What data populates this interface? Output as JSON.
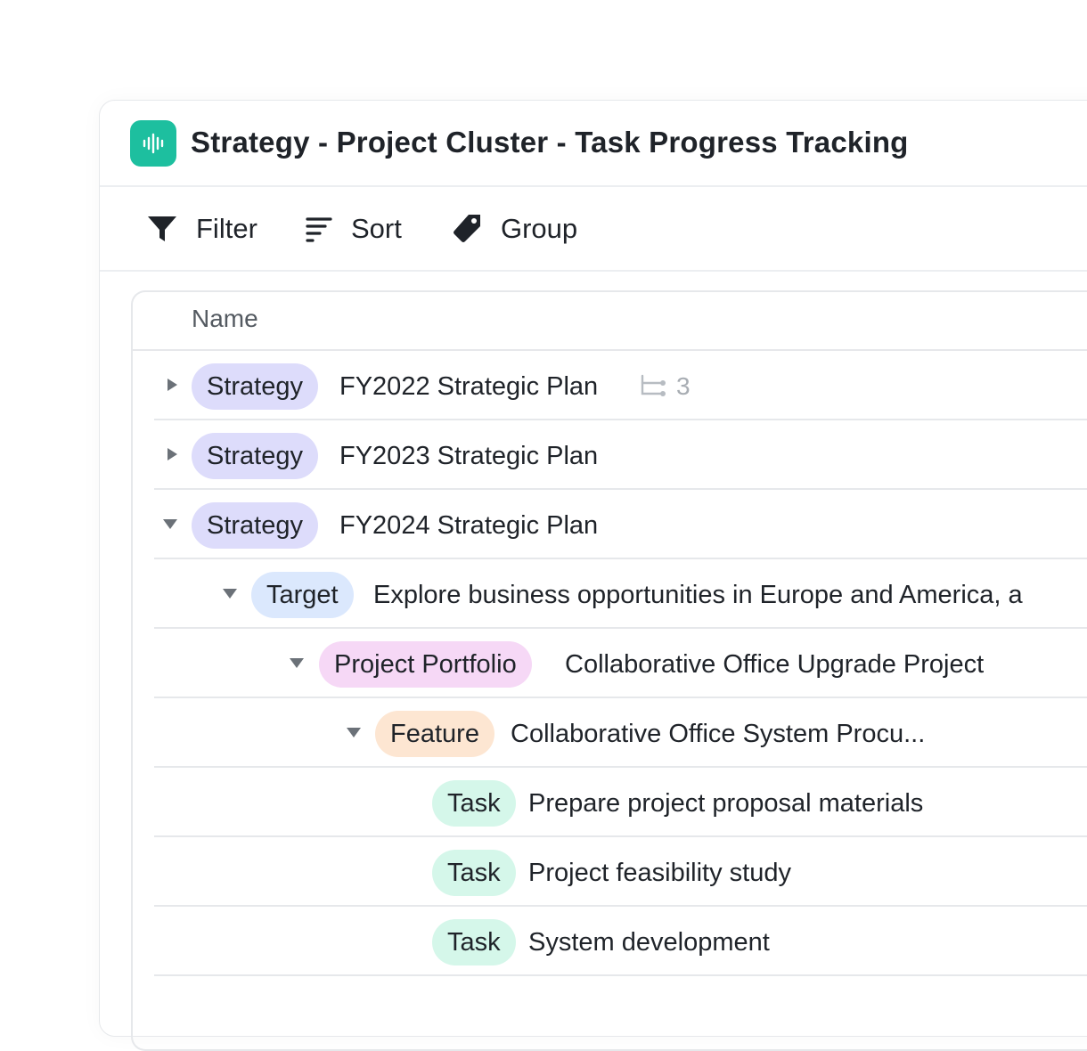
{
  "header": {
    "title": "Strategy - Project Cluster - Task Progress Tracking",
    "app_icon": "waveform-icon",
    "accent": "#1dbf9f"
  },
  "toolbar": {
    "filter_label": "Filter",
    "sort_label": "Sort",
    "group_label": "Group"
  },
  "table": {
    "column_name": "Name",
    "rows": [
      {
        "tag": "Strategy",
        "title": "FY2022 Strategic Plan",
        "subitems": "3",
        "expanded": false
      },
      {
        "tag": "Strategy",
        "title": "FY2023 Strategic Plan",
        "expanded": false
      },
      {
        "tag": "Strategy",
        "title": "FY2024 Strategic Plan",
        "expanded": true
      },
      {
        "tag": "Target",
        "title": "Explore business opportunities in Europe and America, a",
        "expanded": true
      },
      {
        "tag": "Project Portfolio",
        "title": "Collaborative Office Upgrade Project",
        "expanded": true
      },
      {
        "tag": "Feature",
        "title": "Collaborative Office System Procu...",
        "expanded": true
      },
      {
        "tag": "Task",
        "title": "Prepare project proposal materials"
      },
      {
        "tag": "Task",
        "title": "Project feasibility study"
      },
      {
        "tag": "Task",
        "title": "System development"
      }
    ]
  },
  "colors": {
    "strategy": "#dddcfb",
    "target": "#dbe8fd",
    "portfolio": "#f6d8f6",
    "feature": "#fde6d2",
    "task": "#d5f7ea"
  }
}
